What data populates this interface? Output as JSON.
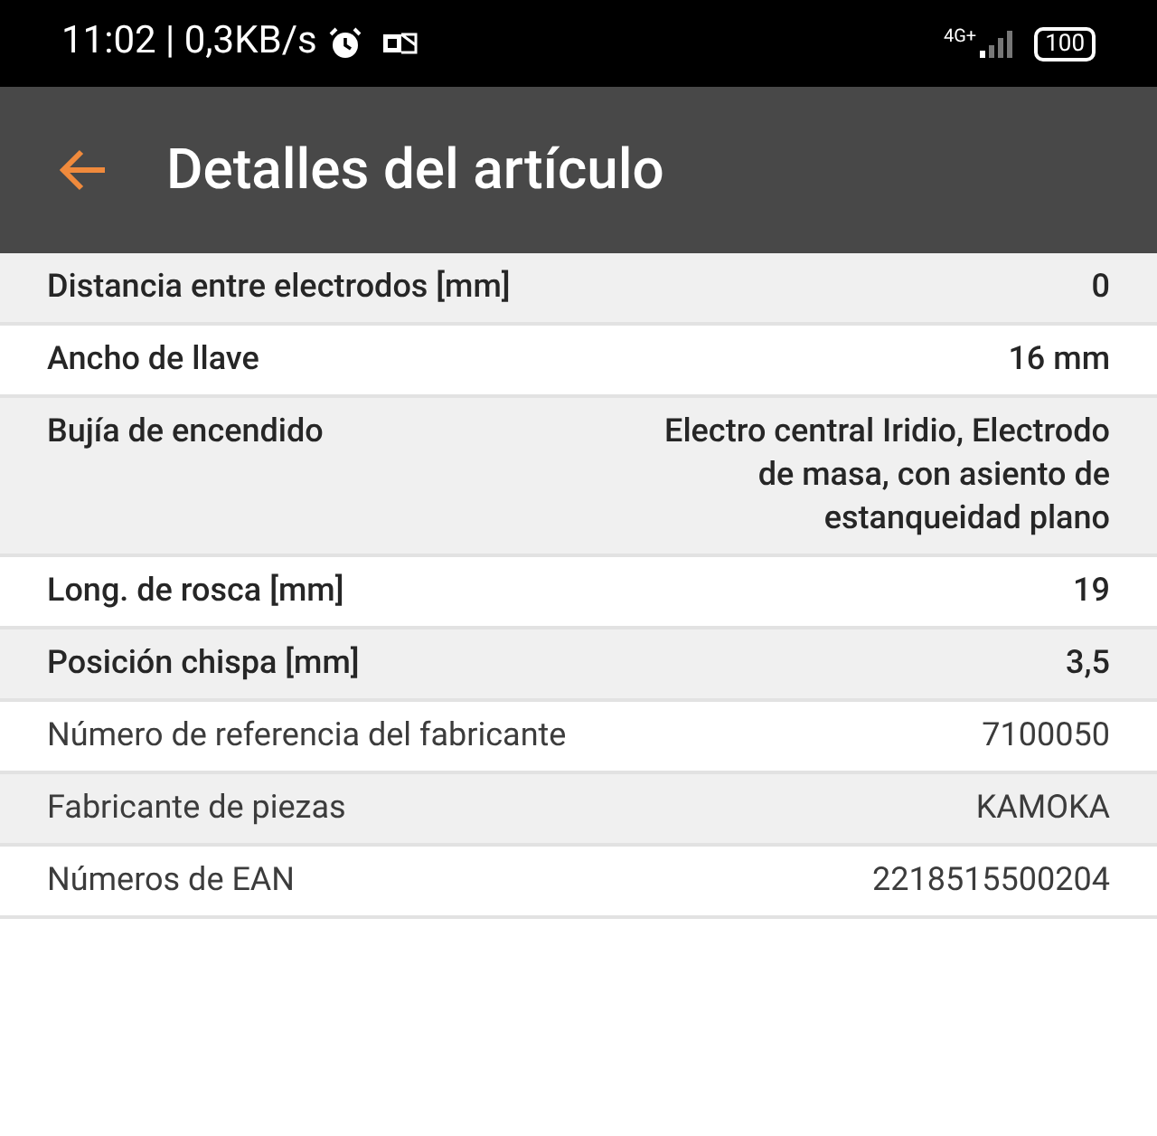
{
  "status_bar": {
    "time": "11:02 | 0,3KB/s",
    "network": "4G+",
    "battery": "100"
  },
  "header": {
    "title": "Detalles del artículo"
  },
  "rows": [
    {
      "label": "Distancia entre electrodos [mm]",
      "value": "0",
      "emphasized": true
    },
    {
      "label": "Ancho de llave",
      "value": "16 mm",
      "emphasized": true
    },
    {
      "label": "Bujía de encendido",
      "value": "Electro central Iridio, Electrodo de masa, con asiento de estanqueidad plano",
      "emphasized": true
    },
    {
      "label": "Long. de rosca [mm]",
      "value": "19",
      "emphasized": true
    },
    {
      "label": "Posición chispa [mm]",
      "value": "3,5",
      "emphasized": true
    },
    {
      "label": "Número de referencia del fabricante",
      "value": "7100050",
      "emphasized": false
    },
    {
      "label": "Fabricante de piezas",
      "value": "KAMOKA",
      "emphasized": false
    },
    {
      "label": "Números de EAN",
      "value": "2218515500204",
      "emphasized": false
    }
  ]
}
